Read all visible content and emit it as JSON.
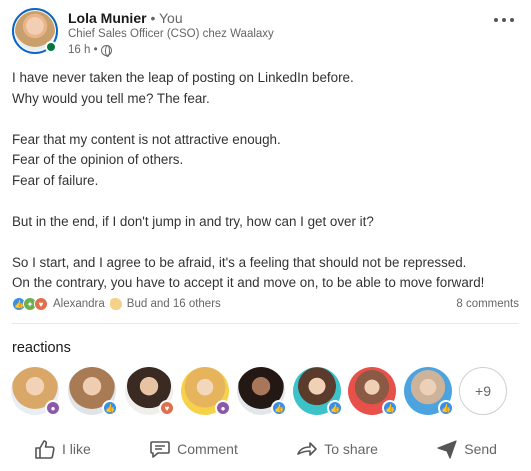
{
  "post": {
    "author_name": "Lola Munier",
    "author_relation": " • You",
    "author_title": "Chief Sales Officer (CSO) chez Waalaxy",
    "time": "16 h •",
    "visibility_icon": "globe-icon",
    "more_icon": "more-horizontal-icon",
    "body_lines": [
      "I have never taken the leap of posting on LinkedIn before.",
      "Why would you tell me? The fear.",
      "",
      "Fear that my content is not attractive enough.",
      "Fear of the opinion of others.",
      "Fear of failure.",
      "",
      "But in the end, if I don't jump in and try, how can I get over it?",
      "",
      "So I start, and I agree to be afraid, it's a feeling that should not be repressed.",
      "On the contrary, you have to accept it and move on, to be able to move forward!"
    ]
  },
  "social": {
    "reaction_icons": [
      "like-icon",
      "celebrate-icon",
      "love-icon"
    ],
    "first_reactor": "Alexandra",
    "second_reactor": "Bud and 16 others",
    "comments": "8 comments"
  },
  "reactions": {
    "title": "reactions",
    "people": [
      {
        "name": "reactor-1",
        "badge": "insight",
        "color": "#c9a06b"
      },
      {
        "name": "reactor-2",
        "badge": "like",
        "color": "#b58a63"
      },
      {
        "name": "reactor-3",
        "badge": "love",
        "color": "#6b4a3a"
      },
      {
        "name": "reactor-4",
        "badge": "insight",
        "color": "#f2c94c"
      },
      {
        "name": "reactor-5",
        "badge": "like",
        "color": "#3b2a25"
      },
      {
        "name": "reactor-6",
        "badge": "like",
        "color": "#3cc3c9"
      },
      {
        "name": "reactor-7",
        "badge": "like",
        "color": "#e8504a"
      },
      {
        "name": "reactor-8",
        "badge": "like",
        "color": "#4da3e0"
      }
    ],
    "more_label": "+9"
  },
  "actions": {
    "like": "I like",
    "comment": "Comment",
    "share": "To share",
    "send": "Send"
  },
  "colors": {
    "accent": "#0a66c2",
    "online": "#057642",
    "like": "#378fe9",
    "love": "#df704d",
    "celebrate": "#6dae4f"
  }
}
